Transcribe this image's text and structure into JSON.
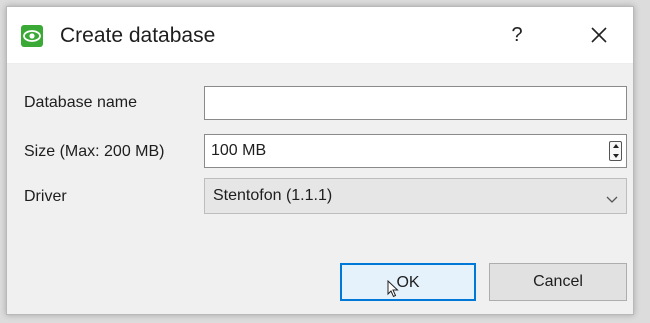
{
  "dialog": {
    "title": "Create database",
    "help_label": "?",
    "app_icon": "eye-logo-icon",
    "close_icon": "close-icon"
  },
  "form": {
    "database_name": {
      "label": "Database name",
      "value": "",
      "placeholder": ""
    },
    "size": {
      "label": "Size (Max: 200 MB)",
      "value": "100 MB"
    },
    "driver": {
      "label": "Driver",
      "selected": "Stentofon (1.1.1)"
    }
  },
  "buttons": {
    "ok_label": "OK",
    "cancel_label": "Cancel"
  },
  "colors": {
    "accent": "#0078d7",
    "app_icon_green": "#3aa935",
    "dialog_bg": "#f0f0f0"
  }
}
